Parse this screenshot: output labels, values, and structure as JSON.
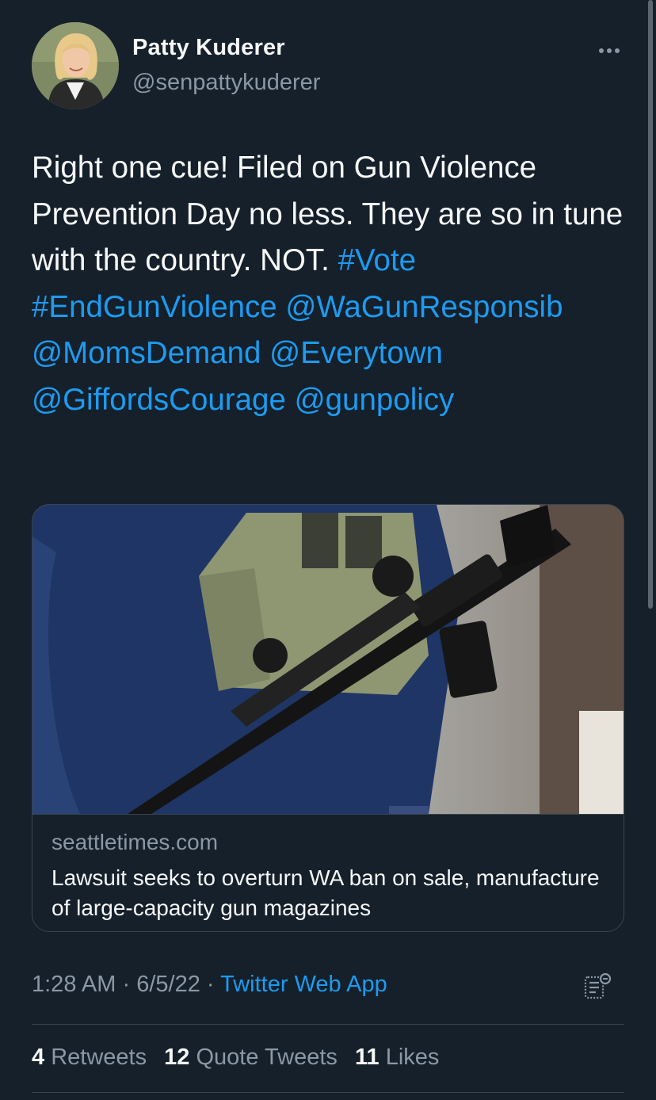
{
  "author": {
    "name": "Patty Kuderer",
    "handle": "@senpattykuderer"
  },
  "tweet": {
    "text_parts": [
      {
        "text": "Right one cue! Filed on Gun Violence Prevention Day no less. They are so in tune with the country. NOT. ",
        "link": false
      },
      {
        "text": "#Vote",
        "link": true
      },
      {
        "text": " ",
        "link": false
      },
      {
        "text": "#EndGunViolence",
        "link": true
      },
      {
        "text": " ",
        "link": false
      },
      {
        "text": "@WaGunResponsib",
        "link": true
      },
      {
        "text": " ",
        "link": false
      },
      {
        "text": "@MomsDemand",
        "link": true
      },
      {
        "text": " ",
        "link": false
      },
      {
        "text": "@Everytown",
        "link": true
      },
      {
        "text": " ",
        "link": false
      },
      {
        "text": "@GiffordsCourage",
        "link": true
      },
      {
        "text": " ",
        "link": false
      },
      {
        "text": "@gunpolicy",
        "link": true
      }
    ]
  },
  "card": {
    "domain": "seattletimes.com",
    "title": "Lawsuit seeks to overturn WA ban on sale, manufacture of large-capacity gun magazines"
  },
  "meta": {
    "time": "1:28 AM",
    "date": "6/5/22",
    "separator": "·",
    "source": "Twitter Web App"
  },
  "stats": {
    "retweets_count": "4",
    "retweets_label": "Retweets",
    "quotes_count": "12",
    "quotes_label": "Quote Tweets",
    "likes_count": "11",
    "likes_label": "Likes"
  },
  "icons": {
    "more": "more-horizontal-icon",
    "analytics": "analytics-icon"
  },
  "colors": {
    "background": "#15202b",
    "text": "#f7f9f9",
    "secondary": "#8b98a5",
    "link": "#1d9bf0",
    "border": "#38444d"
  }
}
